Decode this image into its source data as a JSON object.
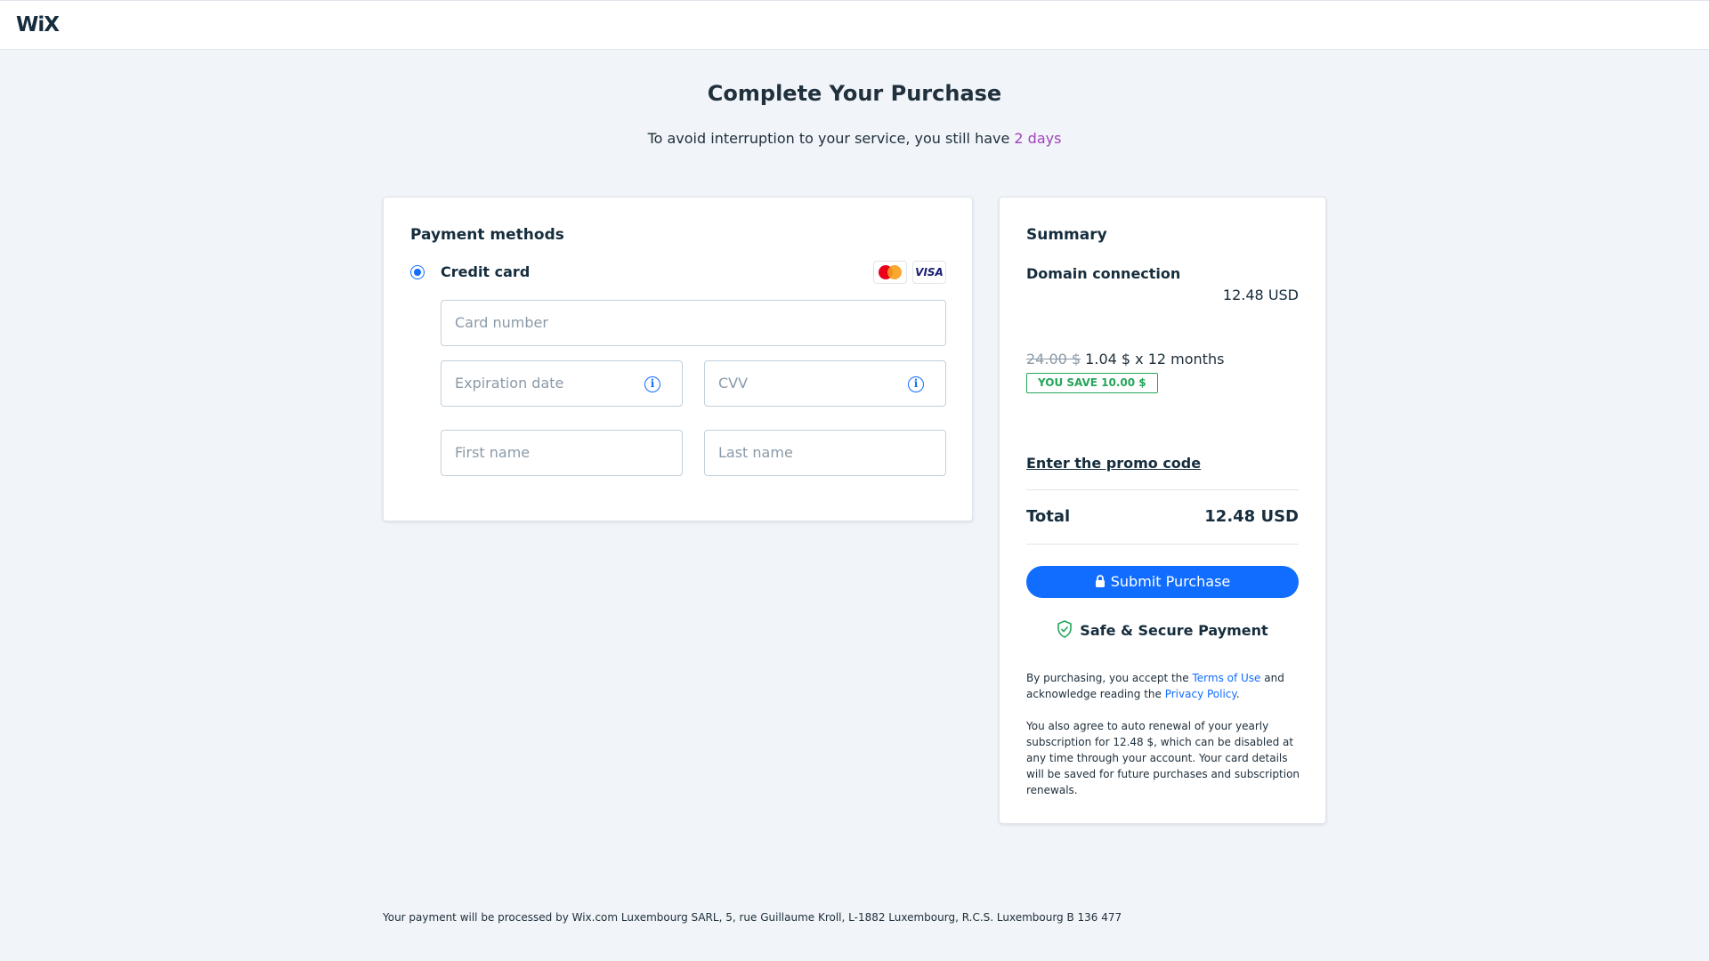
{
  "header": {
    "logo_text": "WiX"
  },
  "page": {
    "title": "Complete Your Purchase",
    "subtitle_prefix": "To avoid interruption to your service, you still have ",
    "subtitle_highlight": "2 days"
  },
  "payment": {
    "title": "Payment methods",
    "method_label": "Credit card",
    "visa_label": "VISA",
    "fields": {
      "card_number": "Card number",
      "expiration_date": "Expiration date",
      "cvv": "CVV",
      "first_name": "First name",
      "last_name": "Last name"
    },
    "info_glyph": "i"
  },
  "summary": {
    "title": "Summary",
    "item_name": "Domain connection",
    "item_price": "12.48 USD",
    "original_price": "24.00 $",
    "monthly_price": "1.04 $ x 12 months",
    "save_badge": "YOU SAVE 10.00 $",
    "promo_link": "Enter the promo code",
    "total_label": "Total",
    "total_value": "12.48 USD",
    "submit_label": "Submit Purchase",
    "secure_label": "Safe & Secure Payment",
    "legal_1_prefix": "By purchasing, you accept the ",
    "terms_link": "Terms of Use",
    "legal_1_mid": " and acknowledge reading the ",
    "privacy_link": "Privacy Policy",
    "legal_1_suffix": ".",
    "legal_2": "You also agree to auto renewal of your yearly subscription for 12.48 $, which can be disabled at any time through your account. Your card details will be saved for future purchases and subscription renewals."
  },
  "footer": {
    "note": "Your payment will be processed by Wix.com Luxembourg SARL, 5, rue Guillaume Kroll, L-1882 Luxembourg, R.C.S. Luxembourg B 136 477"
  },
  "colors": {
    "accent_blue": "#116dff",
    "highlight_purple": "#a23fbb",
    "success_green": "#25a55a",
    "background": "#f1f5f9"
  }
}
